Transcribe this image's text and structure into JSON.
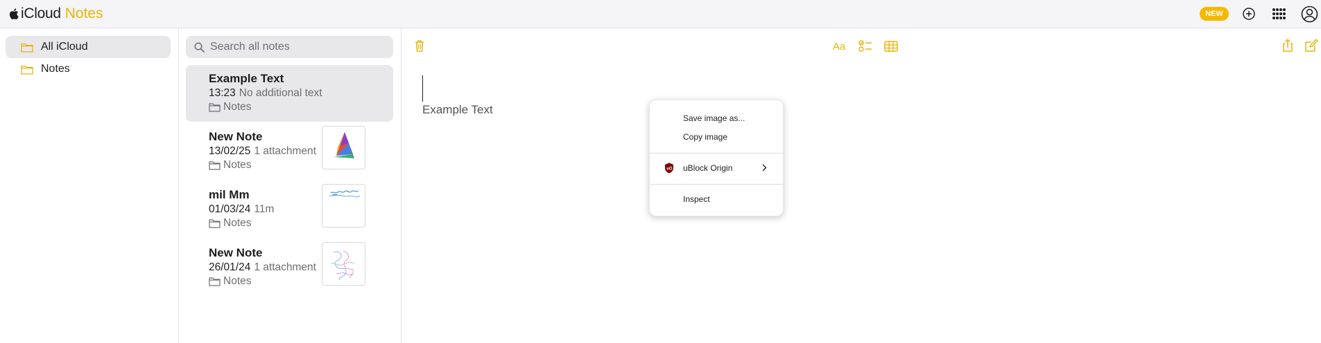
{
  "app": {
    "brand_left": "iCloud",
    "brand_right": "Notes"
  },
  "topbar": {
    "new_badge": "NEW"
  },
  "sidebar": {
    "items": [
      {
        "label": "All iCloud",
        "active": true
      },
      {
        "label": "Notes",
        "active": false
      }
    ]
  },
  "search": {
    "placeholder": "Search all notes"
  },
  "notes": [
    {
      "title": "Example Text",
      "date": "13:23",
      "sub": "No additional text",
      "folder": "Notes"
    },
    {
      "title": "New Note",
      "date": "13/02/25",
      "sub": "1 attachment",
      "folder": "Notes"
    },
    {
      "title": "mil Mm",
      "date": "01/03/24",
      "sub": "11m",
      "folder": "Notes"
    },
    {
      "title": "New Note",
      "date": "26/01/24",
      "sub": "1 attachment",
      "folder": "Notes"
    }
  ],
  "editor": {
    "body_text": "Example Text"
  },
  "context_menu": {
    "save_image": "Save image as...",
    "copy_image": "Copy image",
    "ublock": "uBlock Origin",
    "inspect": "Inspect"
  },
  "colors": {
    "accent": "#e8b30a",
    "badge": "#f5b800",
    "selected": "#e8e8ea",
    "ublock": "#800000"
  }
}
